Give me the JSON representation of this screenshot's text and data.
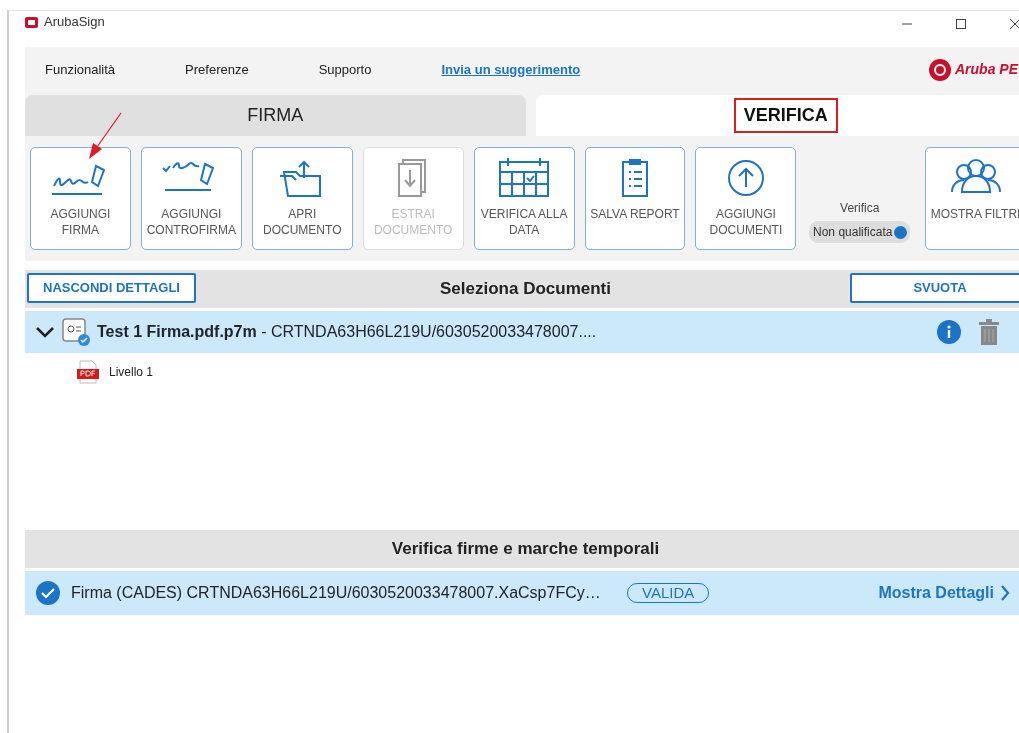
{
  "window": {
    "title": "ArubaSign",
    "logo_text": "Aruba PE"
  },
  "menu": [
    {
      "label": "Funzionalità",
      "kind": "item"
    },
    {
      "label": "Preferenze",
      "kind": "item"
    },
    {
      "label": "Supporto",
      "kind": "item"
    },
    {
      "label": "Invia un suggerimento",
      "kind": "link"
    }
  ],
  "tabs": [
    {
      "label": "FIRMA",
      "selected": false,
      "highlighted": false
    },
    {
      "label": "VERIFICA",
      "selected": true,
      "highlighted": true
    }
  ],
  "toolbar": [
    {
      "label": "AGGIUNGI FIRMA",
      "disabled": false
    },
    {
      "label": "AGGIUNGI CONTROFIRMA",
      "disabled": false
    },
    {
      "label": "APRI DOCUMENTO",
      "disabled": false
    },
    {
      "label": "ESTRAI DOCUMENTO",
      "disabled": true
    },
    {
      "label": "VERIFICA ALLA DATA",
      "disabled": false
    },
    {
      "label": "SALVA REPORT",
      "disabled": false
    },
    {
      "label": "AGGIUNGI DOCUMENTI",
      "disabled": false
    }
  ],
  "verify_toggle": {
    "caption": "Verifica",
    "label": "Non qualificata",
    "on": true
  },
  "filter_button": {
    "label": "MOSTRA FILTRI"
  },
  "documents": {
    "hide_button": "NASCONDI DETTAGLI",
    "title": "Seleziona Documenti",
    "clear_button": "SVUOTA",
    "items": [
      {
        "name": "Test 1 Firma.pdf.p7m",
        "detail": " - CRTNDA63H66L219U/6030520033478007....",
        "expanded": true,
        "selected": true,
        "children": [
          {
            "label": "Livello 1"
          }
        ]
      }
    ]
  },
  "signatures": {
    "title": "Verifica firme e marche temporali",
    "items": [
      {
        "text": "Firma (CADES) CRTNDA63H66L219U/6030520033478007.XaCsp7FCy…",
        "status": "VALIDA",
        "valid": true,
        "link": "Mostra Dettagli",
        "selected": true
      }
    ]
  }
}
